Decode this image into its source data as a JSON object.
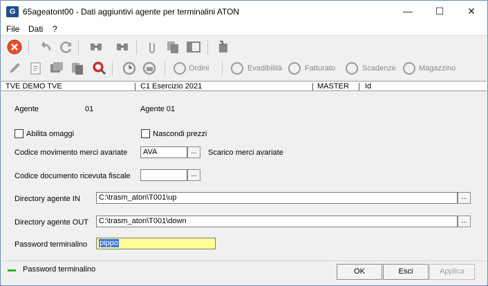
{
  "window": {
    "title": "65ageatont00 - Dati aggiuntivi agente per terminalini ATON",
    "app_icon_letter": "G",
    "minimize_glyph": "—",
    "maximize_glyph": "☐",
    "close_glyph": "✕"
  },
  "menu": {
    "items": [
      "File",
      "Dati",
      "?"
    ]
  },
  "toolbar2": {
    "labels": [
      "Ordini",
      "Evadibilità",
      "Fatturato",
      "Scadenze",
      "Magazzino"
    ]
  },
  "infobar": {
    "company": "TVE DEMO TVE",
    "year": "C1 Esercizio 2021",
    "user": "MASTER",
    "field": "Id"
  },
  "form": {
    "agente_label": "Agente",
    "agente_code": "01",
    "agente_name": "Agente  01",
    "abilita_omaggi_label": "Abilita omaggi",
    "abilita_omaggi_checked": false,
    "nascondi_prezzi_label": "Nascondi prezzi",
    "nascondi_prezzi_checked": false,
    "codice_mov_label": "Codice movimento merci avariate",
    "codice_mov_value": "AVA",
    "codice_mov_desc": "Scarico merci avariate",
    "codice_doc_label": "Codice documento ricevuta fiscale",
    "codice_doc_value": "",
    "dir_in_label": "Directory agente IN",
    "dir_in_value": "C:\\trasm_aton\\T001\\up",
    "dir_out_label": "Directory agente OUT",
    "dir_out_value": "C:\\trasm_aton\\T001\\down",
    "password_label": "Password terminalino",
    "password_value": "pippo",
    "browse_label": "..."
  },
  "status": {
    "legend_text": "Password terminalino",
    "legend_color": "#1bbf1b"
  },
  "buttons": {
    "ok": "OK",
    "esci": "Esci",
    "applica": "Applica"
  }
}
